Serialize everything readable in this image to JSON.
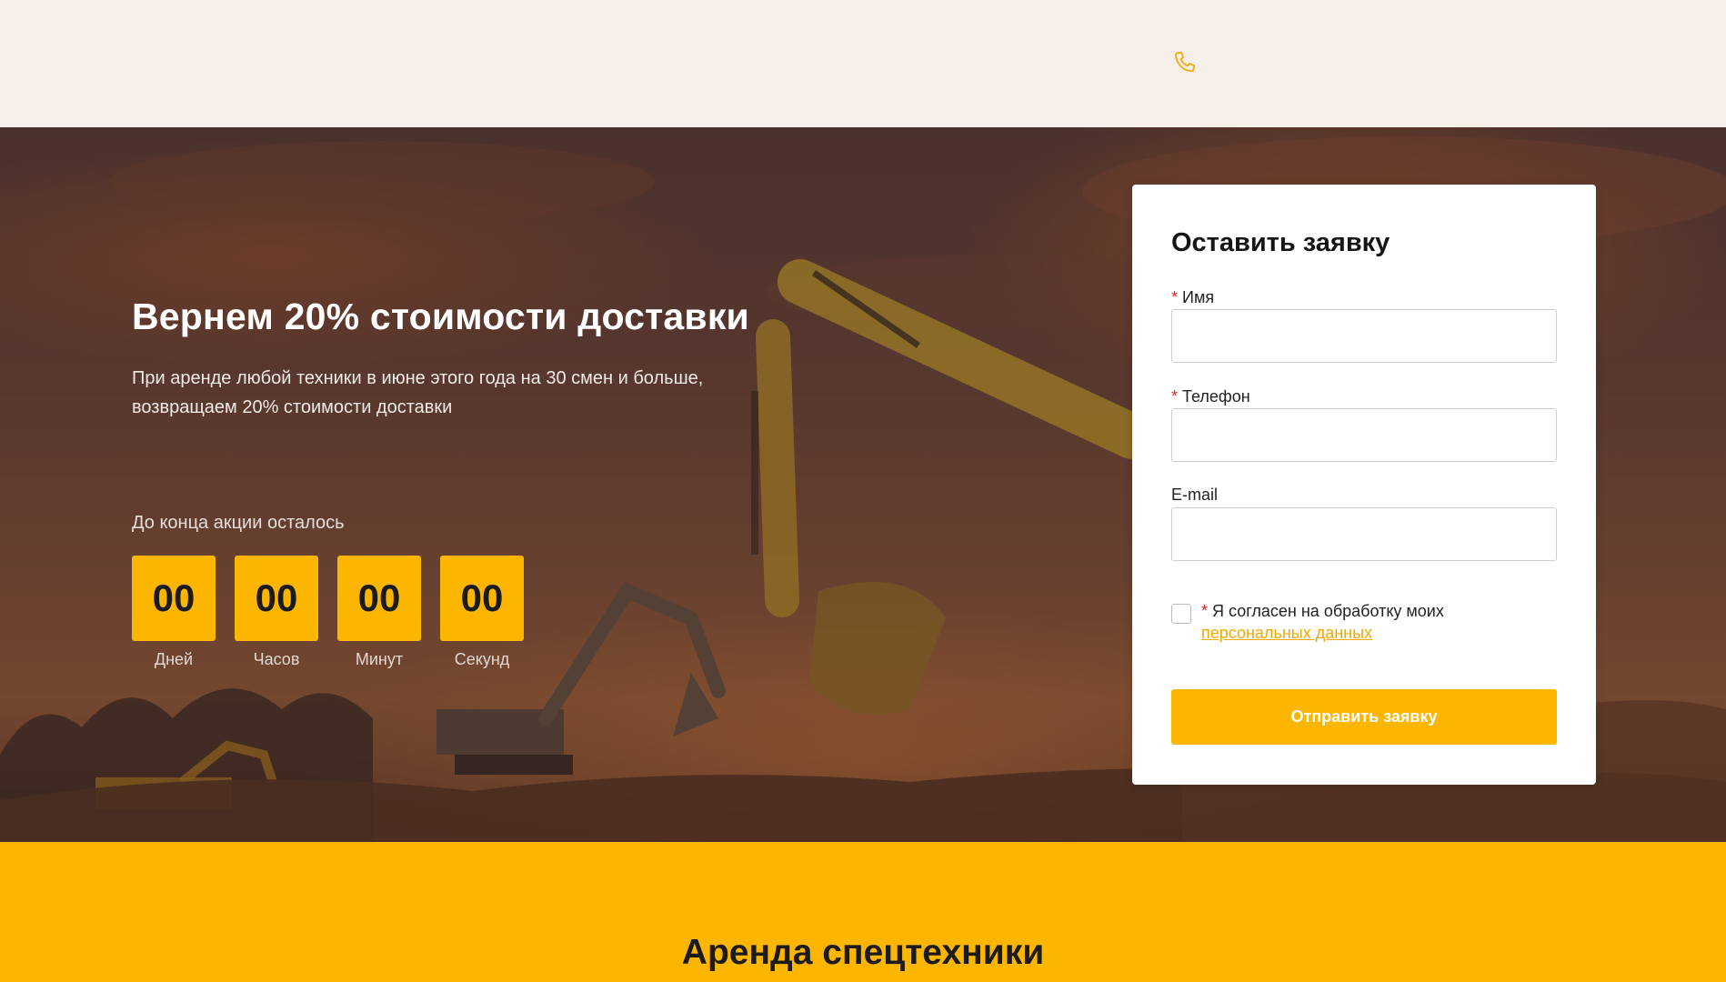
{
  "header": {
    "phone_icon": "phone-icon",
    "accent_color": "#fdb600"
  },
  "hero": {
    "title": "Вернем 20% стоимости доставки",
    "description": "При аренде любой техники в июне этого года на 30 смен и больше, возвращаем 20% стоимости доставки",
    "countdown": {
      "label": "До конца акции осталось",
      "units": [
        {
          "value": "00",
          "caption": "Дней"
        },
        {
          "value": "00",
          "caption": "Часов"
        },
        {
          "value": "00",
          "caption": "Минут"
        },
        {
          "value": "00",
          "caption": "Секунд"
        }
      ]
    }
  },
  "form": {
    "title": "Оставить заявку",
    "fields": {
      "name": {
        "label": "Имя",
        "required": "*",
        "value": ""
      },
      "phone": {
        "label": "Телефон",
        "required": "*",
        "value": ""
      },
      "email": {
        "label": "E-mail",
        "value": ""
      }
    },
    "consent": {
      "required": "*",
      "text": "Я согласен на обработку моих",
      "link_text": "персональных данных",
      "checked": false
    },
    "submit_label": "Отправить заявку"
  },
  "services": {
    "title": "Аренда спецтехники"
  }
}
